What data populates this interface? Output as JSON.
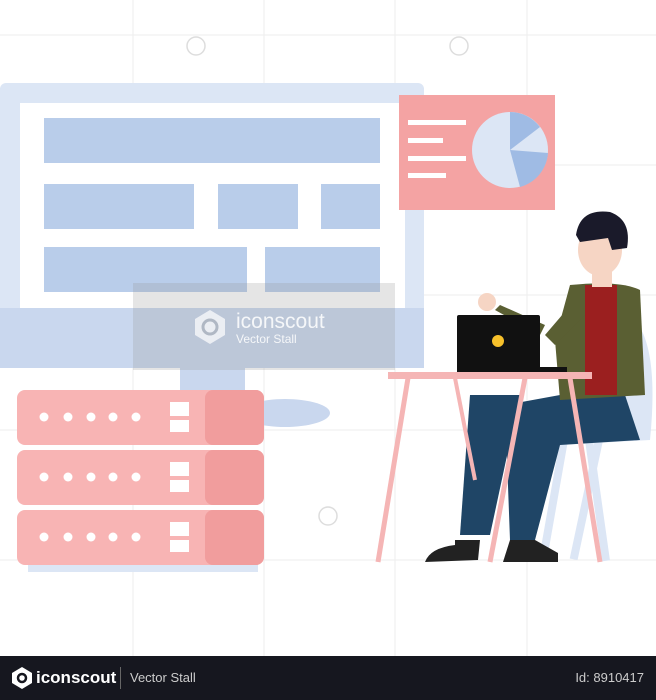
{
  "watermark": {
    "brand": "iconscout",
    "author": "Vector Stall"
  },
  "footer": {
    "brand": "iconscout",
    "author": "Vector Stall",
    "id_label": "Id: 8910417"
  },
  "colors": {
    "monitor": "#dce6f5",
    "blocks": "#b9cdea",
    "card": "#f4a3a3",
    "server": "#f8b4b4",
    "jacket": "#5a5f33",
    "shirt": "#9b1f1f",
    "pants": "#1f4566",
    "footer": "#16171f"
  }
}
